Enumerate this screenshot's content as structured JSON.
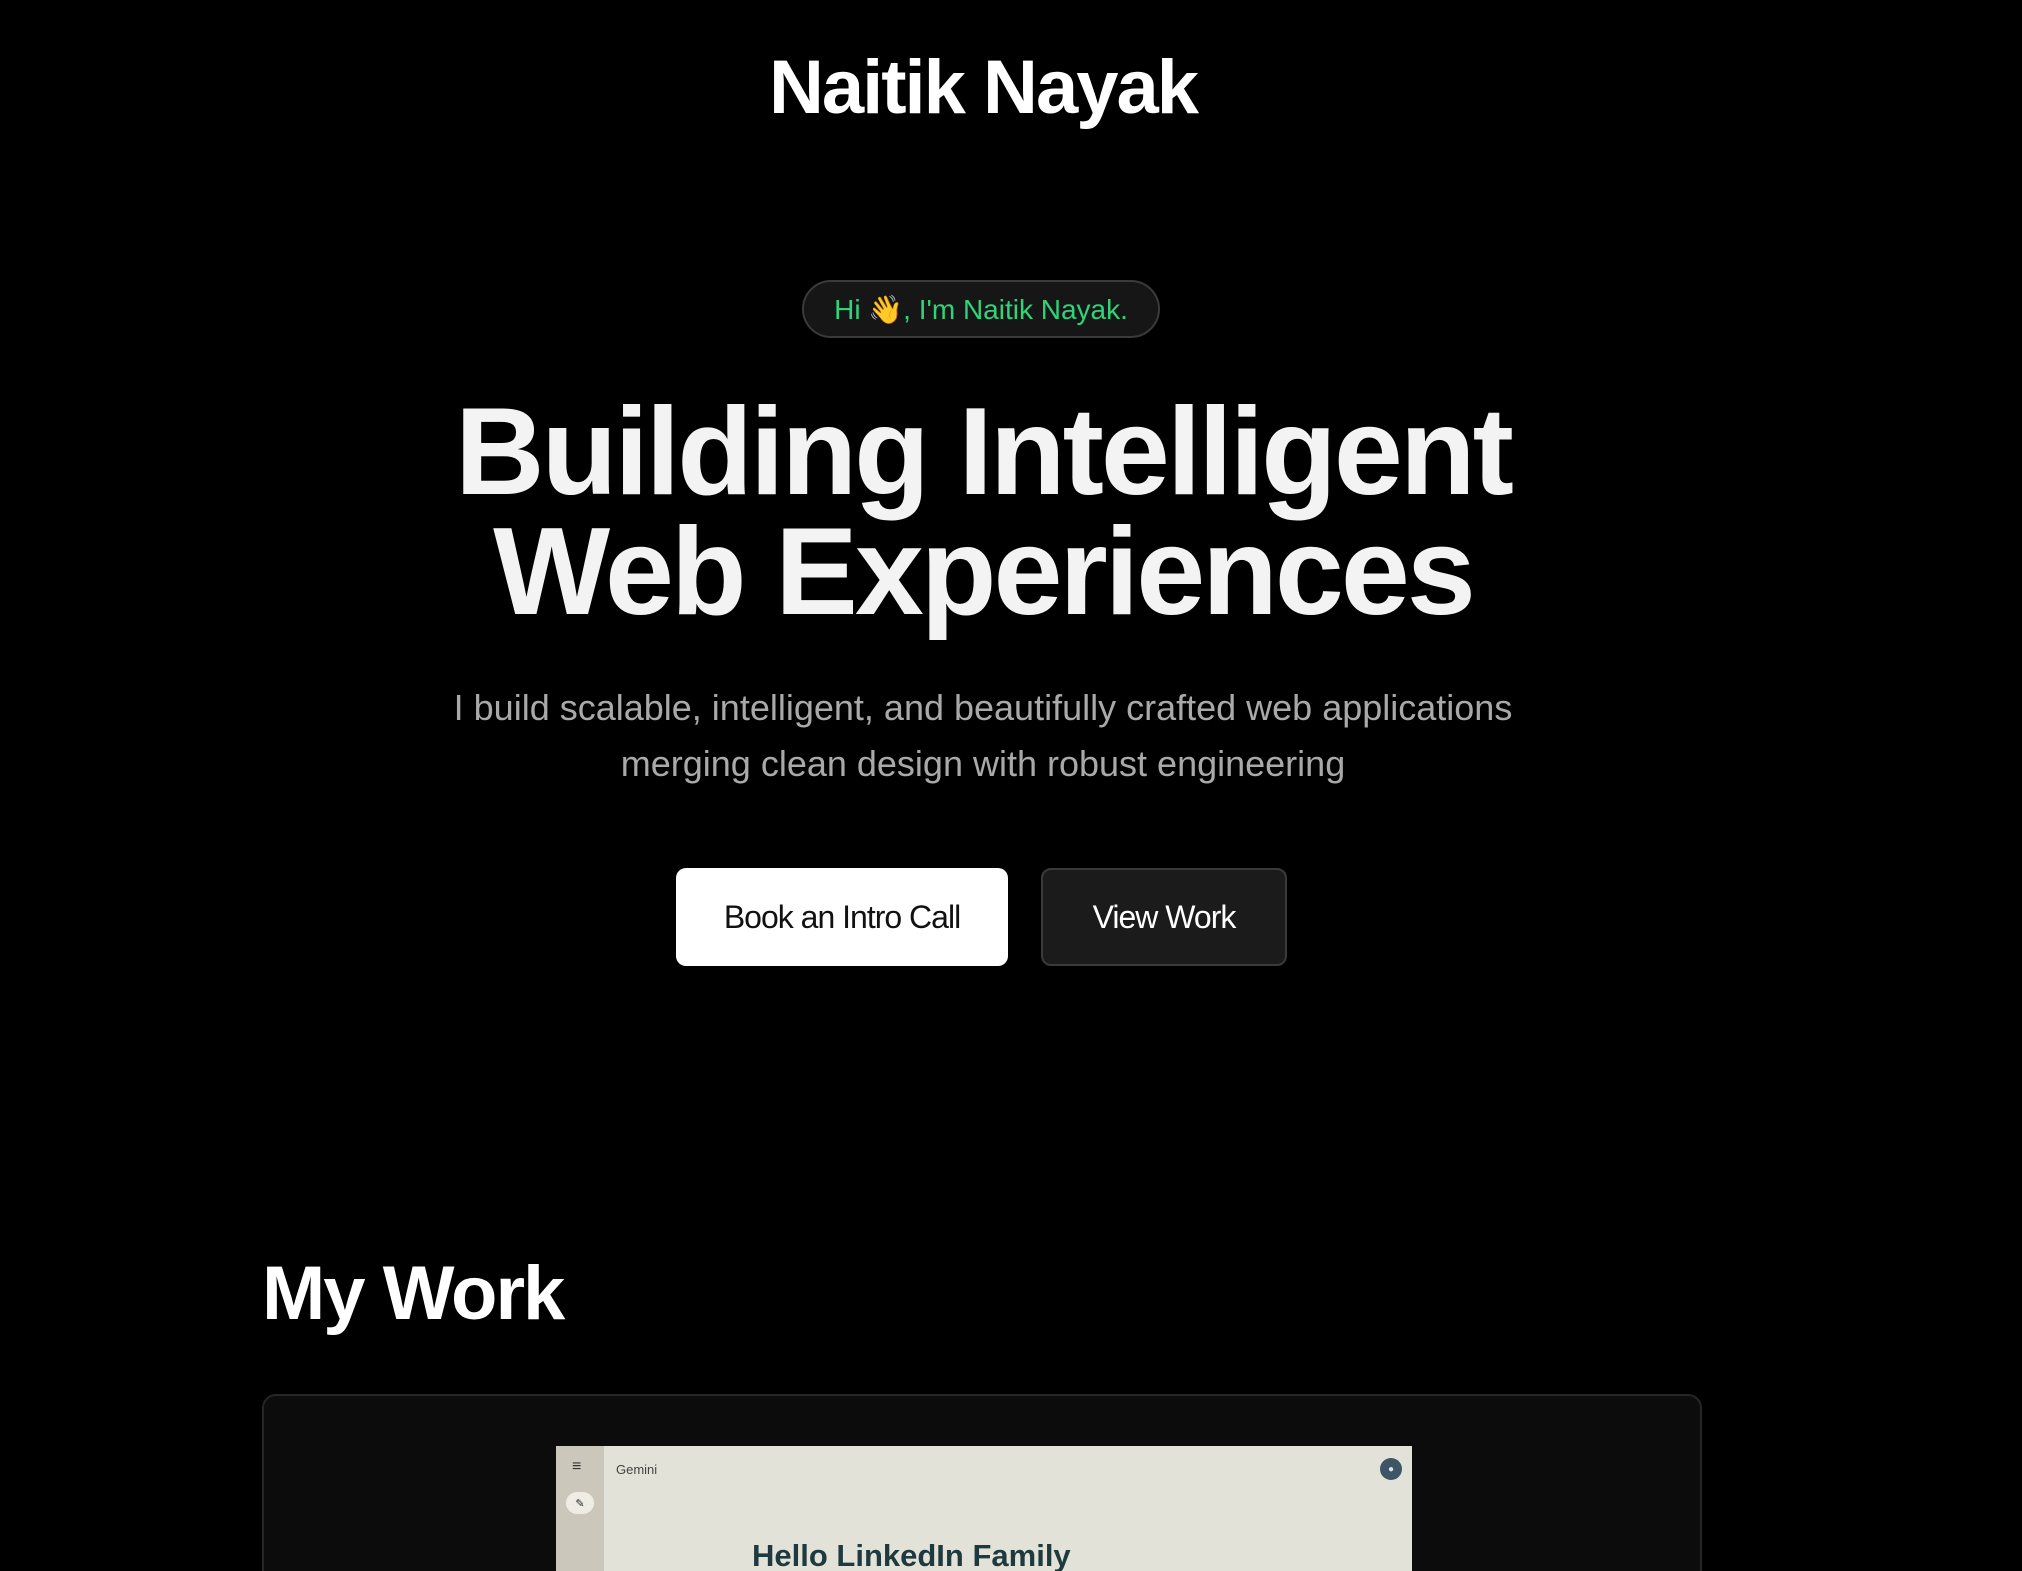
{
  "header": {
    "brand": "Naitik Nayak"
  },
  "hero": {
    "greeting": "Hi 👋, I'm Naitik Nayak.",
    "headline_line1": "Building Intelligent",
    "headline_line2": "Web Experiences",
    "subtitle_line1": "I build scalable, intelligent, and beautifully crafted web applications",
    "subtitle_line2": "merging clean design with robust engineering",
    "primary_button": "Book an Intro Call",
    "secondary_button": "View Work"
  },
  "work": {
    "title": "My Work",
    "preview": {
      "app_name": "Gemini",
      "menu_icon": "menu-icon",
      "new_chat_icon": "new-chat-icon",
      "avatar_icon": "avatar-icon",
      "greeting": "Hello LinkedIn Family"
    }
  },
  "colors": {
    "background": "#000000",
    "accent_green": "#2fd37a",
    "text_primary": "#f3f3f3",
    "text_muted": "#a9a9a9"
  }
}
